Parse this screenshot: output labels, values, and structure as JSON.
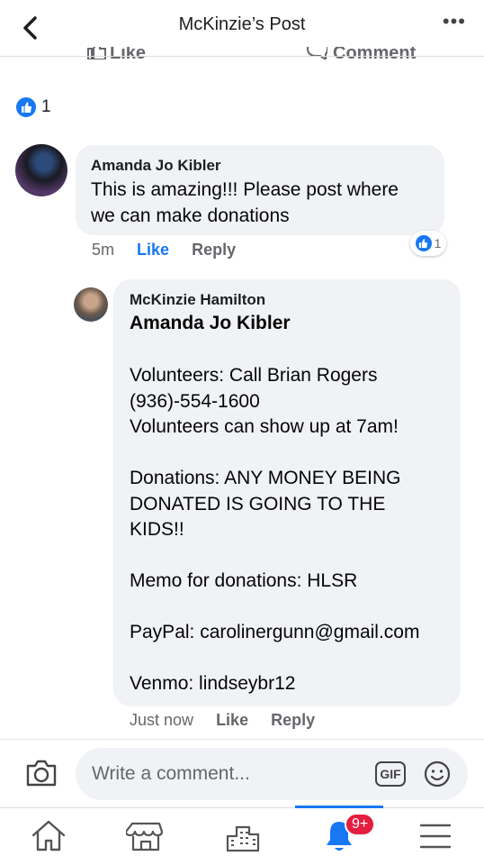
{
  "header": {
    "title": "McKinzie’s Post",
    "more_label": "•••"
  },
  "cut_actions": {
    "like": "Like",
    "comment": "Comment"
  },
  "post": {
    "reaction_count": "1"
  },
  "comments": [
    {
      "author": "Amanda Jo Kibler",
      "lines": [
        "This is amazing!!! Please post where",
        "we can make donations"
      ],
      "time": "5m",
      "like_label": "Like",
      "reply_label": "Reply",
      "reaction_count": "1"
    }
  ],
  "reply": {
    "author": "McKinzie Hamilton",
    "mention": "Amanda Jo Kibler",
    "lines": [
      "Volunteers: Call Brian Rogers",
      "(936)-554-1600",
      "Volunteers can show up at 7am!",
      "Donations: ANY MONEY BEING",
      "DONATED IS GOING TO THE",
      "KIDS!!",
      "Memo for donations: HLSR",
      "PayPal: carolinergunn@gmail.com",
      "Venmo: lindseybr12"
    ],
    "time": "Just now",
    "like_label": "Like",
    "reply_label": "Reply"
  },
  "composer": {
    "placeholder": "Write a comment...",
    "gif_label": "GIF"
  },
  "tabbar": {
    "notifications_badge": "9+"
  },
  "colors": {
    "accent": "#1877f2",
    "bubble": "#f0f2f5",
    "badge": "#e41e3f"
  },
  "icons": [
    "back-arrow-icon",
    "more-icon",
    "like-icon",
    "camera-icon",
    "gif-icon",
    "emoji-icon",
    "home-icon",
    "marketplace-icon",
    "groups-icon",
    "bell-icon",
    "menu-icon"
  ]
}
